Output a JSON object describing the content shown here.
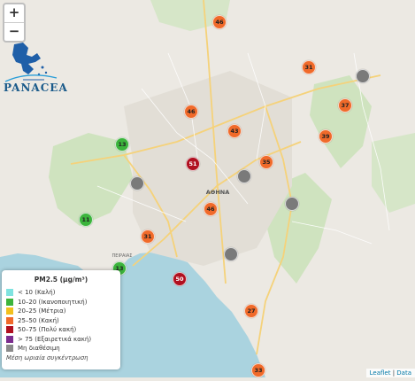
{
  "zoom": {
    "in": "+",
    "out": "−"
  },
  "logo": {
    "text": "PANACEA"
  },
  "place_labels": {
    "city": "ΑΘΗΝΑ",
    "port": "ΠΕΙΡΑΙΑΣ"
  },
  "stations": [
    {
      "value": "46",
      "color": "#f06a2a"
    },
    {
      "value": "31",
      "color": "#f06a2a"
    },
    {
      "value": "",
      "color": "#7a7a7a"
    },
    {
      "value": "37",
      "color": "#f06a2a"
    },
    {
      "value": "46",
      "color": "#f06a2a"
    },
    {
      "value": "43",
      "color": "#f06a2a"
    },
    {
      "value": "39",
      "color": "#f06a2a"
    },
    {
      "value": "13",
      "color": "#3cb43c"
    },
    {
      "value": "51",
      "color": "#b01020"
    },
    {
      "value": "",
      "color": "#7a7a7a"
    },
    {
      "value": "35",
      "color": "#f06a2a"
    },
    {
      "value": "",
      "color": "#7a7a7a"
    },
    {
      "value": "46",
      "color": "#f06a2a"
    },
    {
      "value": "",
      "color": "#7a7a7a"
    },
    {
      "value": "11",
      "color": "#3cb43c"
    },
    {
      "value": "31",
      "color": "#f06a2a"
    },
    {
      "value": "13",
      "color": "#3cb43c"
    },
    {
      "value": "",
      "color": "#7a7a7a"
    },
    {
      "value": "50",
      "color": "#b01020"
    },
    {
      "value": "27",
      "color": "#f06a2a"
    },
    {
      "value": "33",
      "color": "#f06a2a"
    }
  ],
  "legend": {
    "title": "PM2.5 (μg/m³)",
    "items": [
      {
        "label": "< 10 (Καλή)",
        "color": "#7fe3e0"
      },
      {
        "label": "10–20 (Ικανοποιητική)",
        "color": "#3cb43c"
      },
      {
        "label": "20–25 (Μέτρια)",
        "color": "#f2c01e"
      },
      {
        "label": "25–50 (Κακή)",
        "color": "#f06a2a"
      },
      {
        "label": "50–75 (Πολύ κακή)",
        "color": "#b01020"
      },
      {
        "label": "> 75 (Εξαιρετικά κακή)",
        "color": "#7b2d8e"
      },
      {
        "label": "Μη διαθέσιμη",
        "color": "#8a8a8a"
      }
    ],
    "footer": "Μέση ωριαία συγκέντρωση"
  },
  "attribution": {
    "leaflet": "Leaflet",
    "separator": " | ",
    "data": "Data"
  }
}
